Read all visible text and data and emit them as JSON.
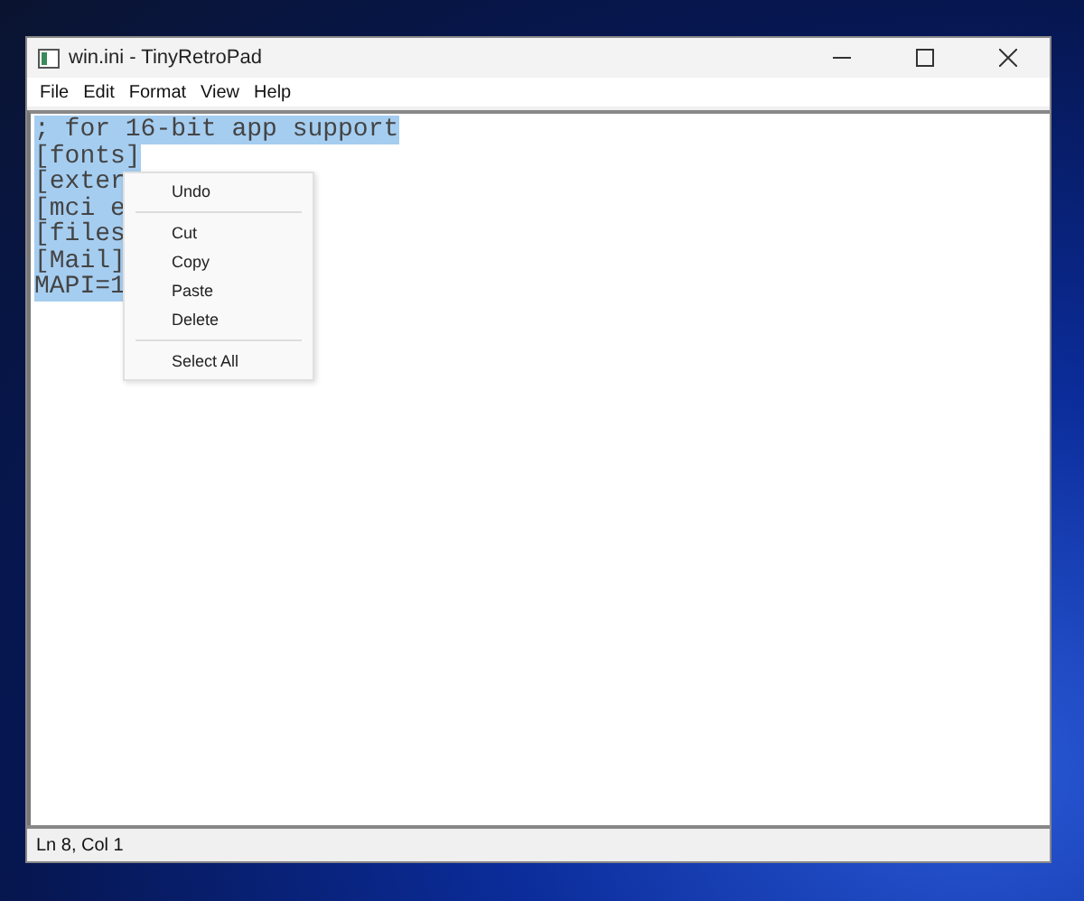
{
  "window": {
    "title": "win.ini - TinyRetroPad"
  },
  "menu_bar": [
    "File",
    "Edit",
    "Format",
    "View",
    "Help"
  ],
  "editor": {
    "selected": true,
    "lines": [
      "; for 16-bit app support",
      "[fonts]",
      "[exter",
      "[mci e",
      "[files",
      "[Mail]",
      "MAPI=1"
    ]
  },
  "context_menu": [
    {
      "kind": "item",
      "label": "Undo"
    },
    {
      "kind": "separator"
    },
    {
      "kind": "item",
      "label": "Cut"
    },
    {
      "kind": "item",
      "label": "Copy"
    },
    {
      "kind": "item",
      "label": "Paste"
    },
    {
      "kind": "item",
      "label": "Delete"
    },
    {
      "kind": "separator"
    },
    {
      "kind": "item",
      "label": "Select All"
    }
  ],
  "status_bar": "Ln 8, Col 1"
}
